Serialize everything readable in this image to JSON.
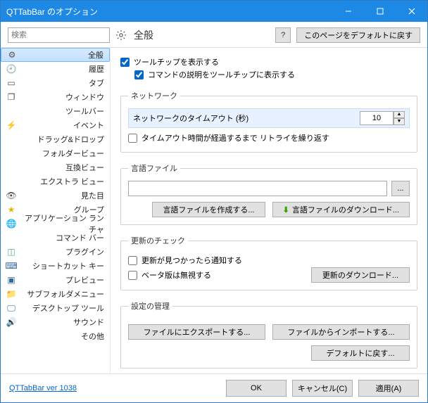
{
  "window_title": "QTTabBar のオプション",
  "search_placeholder": "検索",
  "page_heading": "全般",
  "help_icon_text": "?",
  "reset_page_label": "このページをデフォルトに戻す",
  "sidebar": {
    "items": [
      {
        "icon": "gear",
        "label": "全般"
      },
      {
        "icon": "clock",
        "label": "履歴"
      },
      {
        "icon": "tab",
        "label": "タブ"
      },
      {
        "icon": "window",
        "label": "ウィンドウ"
      },
      {
        "icon": "",
        "label": "ツールバー"
      },
      {
        "icon": "bolt",
        "label": "イベント"
      },
      {
        "icon": "",
        "label": "ドラッグ&ドロップ"
      },
      {
        "icon": "",
        "label": "フォルダービュー"
      },
      {
        "icon": "",
        "label": "互換ビュー"
      },
      {
        "icon": "",
        "label": "エクストラ ビュー"
      },
      {
        "icon": "eye",
        "label": "見た目"
      },
      {
        "icon": "star",
        "label": "グループ"
      },
      {
        "icon": "globe",
        "label": "アプリケーション ランチャ"
      },
      {
        "icon": "",
        "label": "コマンド バー"
      },
      {
        "icon": "plugin",
        "label": "プラグイン"
      },
      {
        "icon": "keyboard",
        "label": "ショートカット キー"
      },
      {
        "icon": "preview",
        "label": "プレビュー"
      },
      {
        "icon": "folder",
        "label": "サブフォルダメニュー"
      },
      {
        "icon": "monitor",
        "label": "デスクトップ ツール"
      },
      {
        "icon": "sound",
        "label": "サウンド"
      },
      {
        "icon": "",
        "label": "その他"
      }
    ]
  },
  "tooltips": {
    "chk_show": "ツールチップを表示する",
    "chk_desc": "コマンドの説明をツールチップに表示する"
  },
  "network": {
    "legend": "ネットワーク",
    "timeout_label": "ネットワークのタイムアウト (秒)",
    "timeout_value": "10",
    "retry_chk": "タイムアウト時間が経過するまで リトライを繰り返す"
  },
  "langfile": {
    "legend": "言語ファイル",
    "value": "",
    "browse": "...",
    "create_btn": "言語ファイルを作成する...",
    "download_btn": "言語ファイルのダウンロード..."
  },
  "updates": {
    "legend": "更新のチェック",
    "notify_chk": "更新が見つかったら通知する",
    "ignore_beta_chk": "ベータ版は無視する",
    "download_btn": "更新のダウンロード..."
  },
  "settings": {
    "legend": "設定の管理",
    "export_btn": "ファイルにエクスポートする...",
    "import_btn": "ファイルからインポートする...",
    "default_btn": "デフォルトに戻す..."
  },
  "footer": {
    "version_link": "QTTabBar ver 1038",
    "ok": "OK",
    "cancel": "キャンセル(C)",
    "apply": "適用(A)"
  }
}
